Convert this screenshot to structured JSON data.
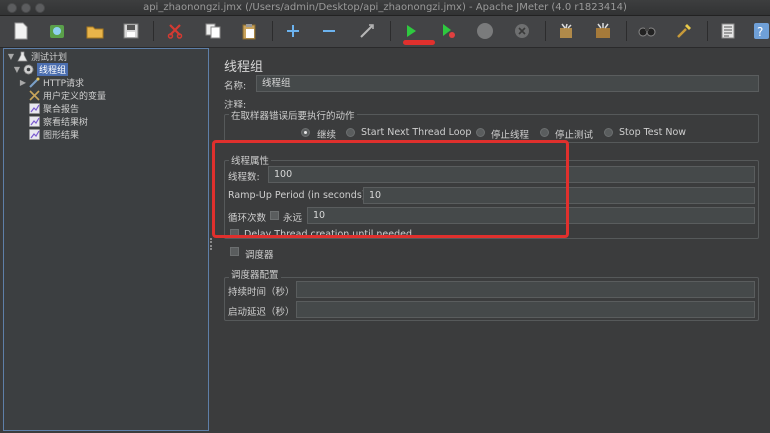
{
  "window": {
    "title": "api_zhaonongzi.jmx (/Users/admin/Desktop/api_zhaonongzi.jmx) - Apache JMeter (4.0 r1823414)"
  },
  "toolbar": {
    "buttons": [
      "new-file-icon",
      "templates-icon",
      "open-icon",
      "save-icon",
      "cut-icon",
      "copy-icon",
      "paste-icon",
      "expand-icon",
      "collapse-icon",
      "toggle-icon",
      "start-icon",
      "start-no-pause-icon",
      "stop-icon",
      "shutdown-icon",
      "clear-icon",
      "clear-all-icon",
      "search-icon",
      "reset-search-icon",
      "function-helper-icon",
      "help-icon"
    ],
    "highlight_color": "#e0302d"
  },
  "tree": {
    "items": [
      {
        "label": "测试计划",
        "icon": "test-plan-icon"
      },
      {
        "label": "线程组",
        "icon": "thread-group-gear-icon"
      },
      {
        "label": "HTTP请求",
        "icon": "http-sampler-icon"
      },
      {
        "label": "用户定义的变量",
        "icon": "config-variables-icon"
      },
      {
        "label": "聚合报告",
        "icon": "listener-chart-icon"
      },
      {
        "label": "察看结果树",
        "icon": "listener-chart-icon"
      },
      {
        "label": "图形结果",
        "icon": "listener-chart-icon"
      }
    ]
  },
  "panel": {
    "title": "线程组",
    "name_label": "名称:",
    "name_value": "线程组",
    "comment_label": "注释:",
    "comment_value": "",
    "error_action": {
      "title": "在取样器错误后要执行的动作",
      "options": [
        "继续",
        "Start Next Thread Loop",
        "停止线程",
        "停止测试",
        "Stop Test Now"
      ],
      "selected": "继续"
    },
    "thread_props": {
      "title": "线程属性",
      "threads_label": "线程数:",
      "threads_value": "100",
      "rampup_label": "Ramp-Up Period (in seconds):",
      "rampup_value": "10",
      "loop_label": "循环次数",
      "forever_label": "永远",
      "loop_value": "10",
      "delay_label": "Delay Thread creation until needed"
    },
    "scheduler_label": "调度器",
    "scheduler_config": {
      "title": "调度器配置",
      "duration_label": "持续时间（秒）",
      "duration_value": "",
      "startup_delay_label": "启动延迟（秒）",
      "startup_delay_value": ""
    }
  }
}
